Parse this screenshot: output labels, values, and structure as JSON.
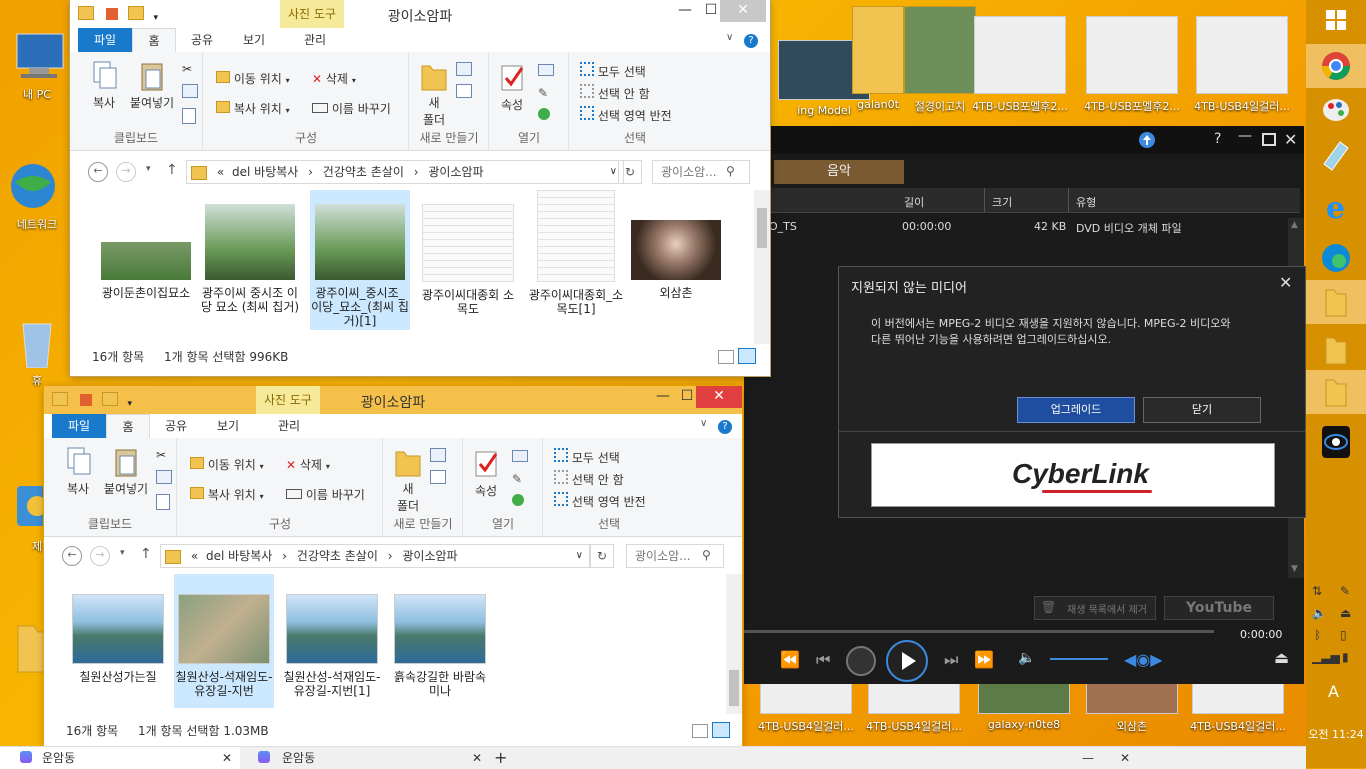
{
  "desktop": {
    "left_icons": [
      {
        "label": "내 PC",
        "icon": "computer-icon"
      },
      {
        "label": "네트워크",
        "icon": "network-icon"
      },
      {
        "label": "휴",
        "icon": "recycle-bin-icon"
      },
      {
        "label": "제",
        "icon": "control-panel-icon"
      }
    ],
    "top_icons": [
      {
        "label": "ing Model",
        "icon": "video-thumbnail-icon"
      },
      {
        "label": "galan0t",
        "icon": "folder-icon"
      },
      {
        "label": "절경이고치",
        "icon": "folder-icon"
      },
      {
        "label": "4TB-USB포멜후2...",
        "icon": "image-thumbnail-icon"
      },
      {
        "label": "4TB-USB포멜후2...",
        "icon": "image-thumbnail-icon"
      },
      {
        "label": "4TB-USB4일걸러...",
        "icon": "image-thumbnail-icon"
      }
    ],
    "bottom_icons": [
      {
        "label": "4TB-USB4일걸러...",
        "icon": "image-thumbnail-icon"
      },
      {
        "label": "4TB-USB4일걸러...",
        "icon": "image-thumbnail-icon"
      },
      {
        "label": "galaxy-n0te8",
        "icon": "image-thumbnail-icon"
      },
      {
        "label": "외삼촌",
        "icon": "image-thumbnail-icon"
      },
      {
        "label": "4TB-USB4일걸러...",
        "icon": "image-thumbnail-icon"
      }
    ]
  },
  "explorer1": {
    "title": "광이소암파",
    "photo_tools": "사진 도구",
    "tabs": [
      "파일",
      "홈",
      "공유",
      "보기",
      "관리"
    ],
    "ribbon": {
      "copy": "복사",
      "paste": "붙여넣기",
      "move_to": "이동 위치",
      "copy_to": "복사 위치",
      "delete": "삭제",
      "rename": "이름 바꾸기",
      "new_folder_1": "새",
      "new_folder_2": "폴더",
      "properties": "속성",
      "select_all": "모두 선택",
      "select_none": "선택 안 함",
      "invert_selection": "선택 영역 반전",
      "groups": [
        "클립보드",
        "구성",
        "새로 만들기",
        "열기",
        "선택"
      ]
    },
    "address": {
      "prefix": "«",
      "crumbs": [
        "del 바탕복사",
        "건강약초 촌살이",
        "광이소암파"
      ],
      "search_placeholder": "광이소암..."
    },
    "items": [
      {
        "name": "광이둔촌이집묘소"
      },
      {
        "name": "광주이씨 중시조 이당 묘소 (최씨 칩거)"
      },
      {
        "name": "광주이씨_중시조_이당_묘소_(최씨 칩거)[1]"
      },
      {
        "name": "광주이씨대종회 소목도"
      },
      {
        "name": "광주이씨대종회_소목도[1]"
      },
      {
        "name": "외삼촌"
      }
    ],
    "status": {
      "count": "16개 항목",
      "selected": "1개 항목 선택함 996KB"
    }
  },
  "explorer2": {
    "title": "광이소암파",
    "photo_tools": "사진 도구",
    "tabs": [
      "파일",
      "홈",
      "공유",
      "보기",
      "관리"
    ],
    "address": {
      "prefix": "«",
      "crumbs": [
        "del 바탕복사",
        "건강약초 촌살이",
        "광이소암파"
      ],
      "search_placeholder": "광이소암..."
    },
    "items": [
      {
        "name": "칠원산성가는질"
      },
      {
        "name": "칠원산성-석재임도-유장길-지번"
      },
      {
        "name": "칠원산성-석재임도-유장길-지번[1]"
      },
      {
        "name": "흙속강길한 바람속미나"
      }
    ],
    "status": {
      "count": "16개 항목",
      "selected": "1개 항목 선택함 1.03MB"
    }
  },
  "player": {
    "tab_music": "음악",
    "columns": [
      "길이",
      "크기",
      "유형"
    ],
    "row": {
      "name": "EO_TS",
      "length": "00:00:00",
      "size": "42 KB",
      "type": "DVD 비디오 개체 파일"
    },
    "remove_label": "재생 목록에서 제거",
    "youtube_label": "YouTube",
    "time": "0:00:00"
  },
  "dialog": {
    "title": "지원되지 않는 미디어",
    "message_1": "이 버전에서는 MPEG-2 비디오 재생을 지원하지 않습니다. MPEG-2 비디오와",
    "message_2": "다른 뛰어난 기능을 사용하려면 업그레이드하십시오.",
    "upgrade": "업그레이드",
    "close": "닫기",
    "brand": "CyberLink"
  },
  "taskbar": {
    "clock": "오전 11:24",
    "ime": "A"
  },
  "bottom_tabs": [
    {
      "label": "운암동"
    },
    {
      "label": "운암동"
    }
  ],
  "colors": {
    "desktop": "#f29a00",
    "accent": "#1979ca",
    "selection": "#cce8ff",
    "close_red": "#e04040"
  }
}
